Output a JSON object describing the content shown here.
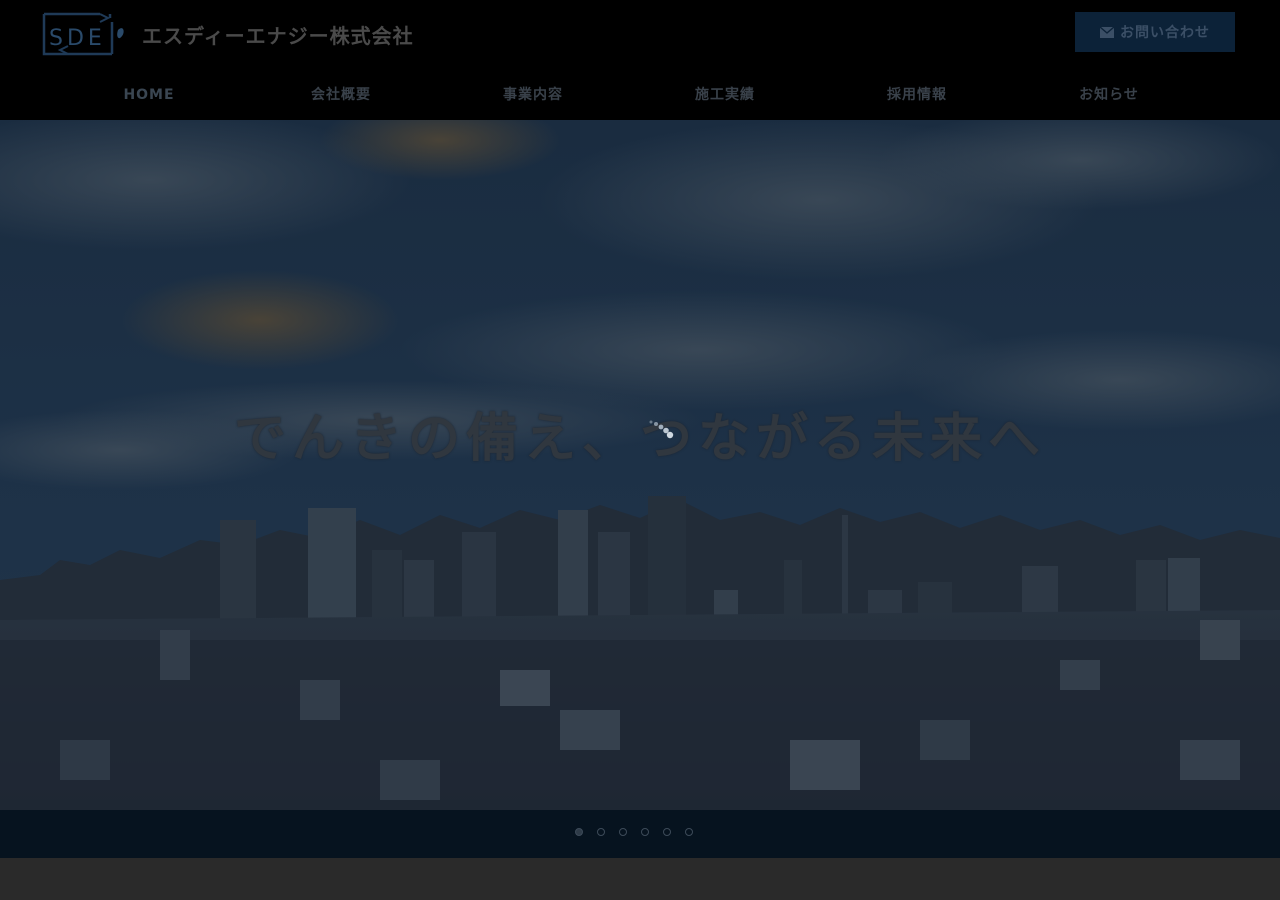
{
  "header": {
    "logo_text": "SDE",
    "company_name": "エスディーエナジー株式会社",
    "contact_button": "お問い合わせ",
    "contact_icon": "mail-icon"
  },
  "nav": {
    "items": [
      {
        "label": "HOME"
      },
      {
        "label": "会社概要"
      },
      {
        "label": "事業内容"
      },
      {
        "label": "施工実績"
      },
      {
        "label": "採用情報"
      },
      {
        "label": "お知らせ"
      }
    ]
  },
  "hero": {
    "slogan": "でんきの備え、つながる未来へ",
    "slide_count": 6,
    "active_slide": 1
  },
  "colors": {
    "background": "#000000",
    "button": "#0c2238",
    "sky_top": "#16273a",
    "city": "#1b2533"
  }
}
